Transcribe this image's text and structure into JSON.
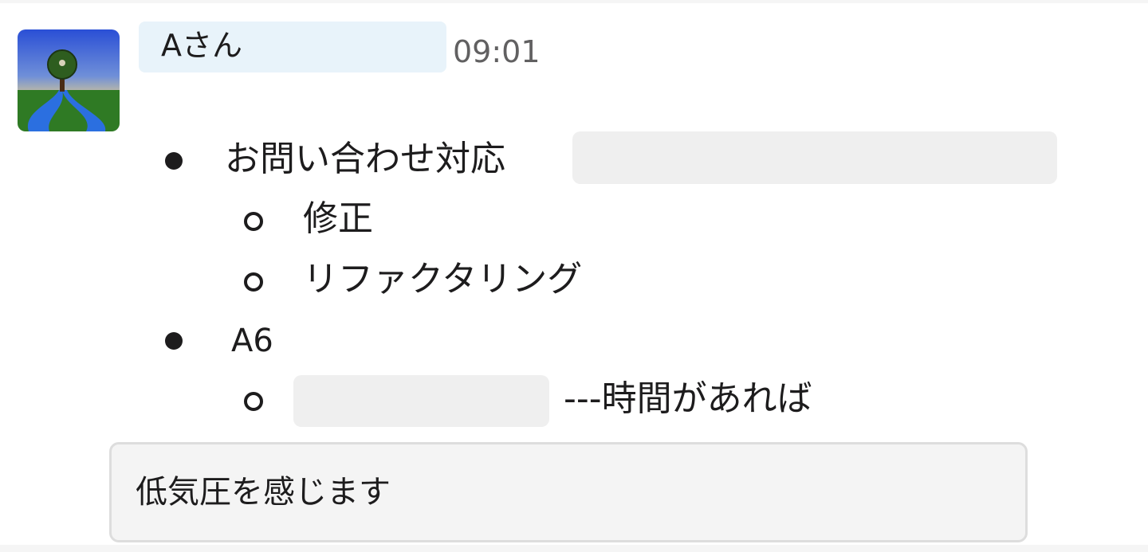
{
  "message": {
    "sender": "Aさん",
    "time": "09:01",
    "avatar_icon": "tree-landscape-avatar",
    "list": [
      {
        "text": "お問い合わせ対応",
        "redacted_after": true,
        "children": [
          {
            "text": "修正"
          },
          {
            "text": "リファクタリング"
          }
        ]
      },
      {
        "text": "A6",
        "children": [
          {
            "text": "---時間があれば",
            "redacted_before": true
          }
        ]
      }
    ],
    "quote": "低気圧を感じます"
  },
  "colors": {
    "name_highlight": "#e8f3fa",
    "redaction": "#efefef",
    "timestamp": "#616061",
    "quote_background": "#f4f4f4"
  }
}
